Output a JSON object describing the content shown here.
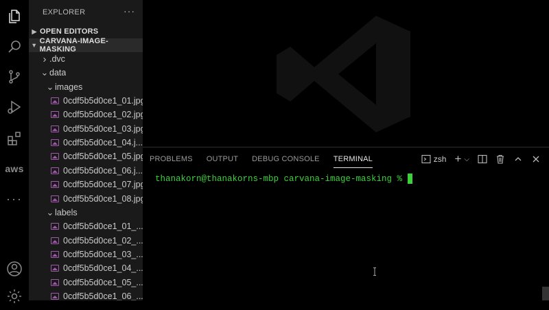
{
  "activity_bar": {
    "items": [
      "files-icon",
      "search-icon",
      "source-control-icon",
      "run-debug-icon",
      "extensions-icon",
      "aws-icon",
      "more-icon",
      "account-icon",
      "settings-gear-icon"
    ],
    "aws_label": "aws",
    "more_label": "···"
  },
  "sidebar": {
    "title": "EXPLORER",
    "more": "···",
    "sections": {
      "open_editors": "OPEN EDITORS",
      "project": "CARVANA-IMAGE-MASKING"
    },
    "tree": [
      {
        "label": ".dvc",
        "type": "folder",
        "expanded": false,
        "depth": 1
      },
      {
        "label": "data",
        "type": "folder",
        "expanded": true,
        "depth": 1
      },
      {
        "label": "images",
        "type": "folder",
        "expanded": true,
        "depth": 2
      },
      {
        "label": "0cdf5b5d0ce1_01.jpg",
        "type": "image",
        "depth": 3
      },
      {
        "label": "0cdf5b5d0ce1_02.jpg",
        "type": "image",
        "depth": 3
      },
      {
        "label": "0cdf5b5d0ce1_03.jpg",
        "type": "image",
        "depth": 3
      },
      {
        "label": "0cdf5b5d0ce1_04.j...",
        "type": "image",
        "depth": 3
      },
      {
        "label": "0cdf5b5d0ce1_05.jpg",
        "type": "image",
        "depth": 3
      },
      {
        "label": "0cdf5b5d0ce1_06.j...",
        "type": "image",
        "depth": 3
      },
      {
        "label": "0cdf5b5d0ce1_07.jpg",
        "type": "image",
        "depth": 3
      },
      {
        "label": "0cdf5b5d0ce1_08.jpg",
        "type": "image",
        "depth": 3
      },
      {
        "label": "labels",
        "type": "folder",
        "expanded": true,
        "depth": 2
      },
      {
        "label": "0cdf5b5d0ce1_01_...",
        "type": "image",
        "depth": 3
      },
      {
        "label": "0cdf5b5d0ce1_02_...",
        "type": "image",
        "depth": 3
      },
      {
        "label": "0cdf5b5d0ce1_03_...",
        "type": "image",
        "depth": 3
      },
      {
        "label": "0cdf5b5d0ce1_04_...",
        "type": "image",
        "depth": 3
      },
      {
        "label": "0cdf5b5d0ce1_05_...",
        "type": "image",
        "depth": 3
      },
      {
        "label": "0cdf5b5d0ce1_06_...",
        "type": "image",
        "depth": 3
      }
    ]
  },
  "panel": {
    "tabs": [
      "PROBLEMS",
      "OUTPUT",
      "DEBUG CONSOLE",
      "TERMINAL"
    ],
    "active_tab": "TERMINAL",
    "shell": "zsh",
    "add": "+",
    "dropdown": "⌵",
    "prompt": "thanakorn@thanakorns-mbp carvana-image-masking %"
  },
  "colors": {
    "terminal_green": "#3ad13a",
    "image_icon": "#a05aaa",
    "sidebar_bg": "#1a1a1a"
  }
}
